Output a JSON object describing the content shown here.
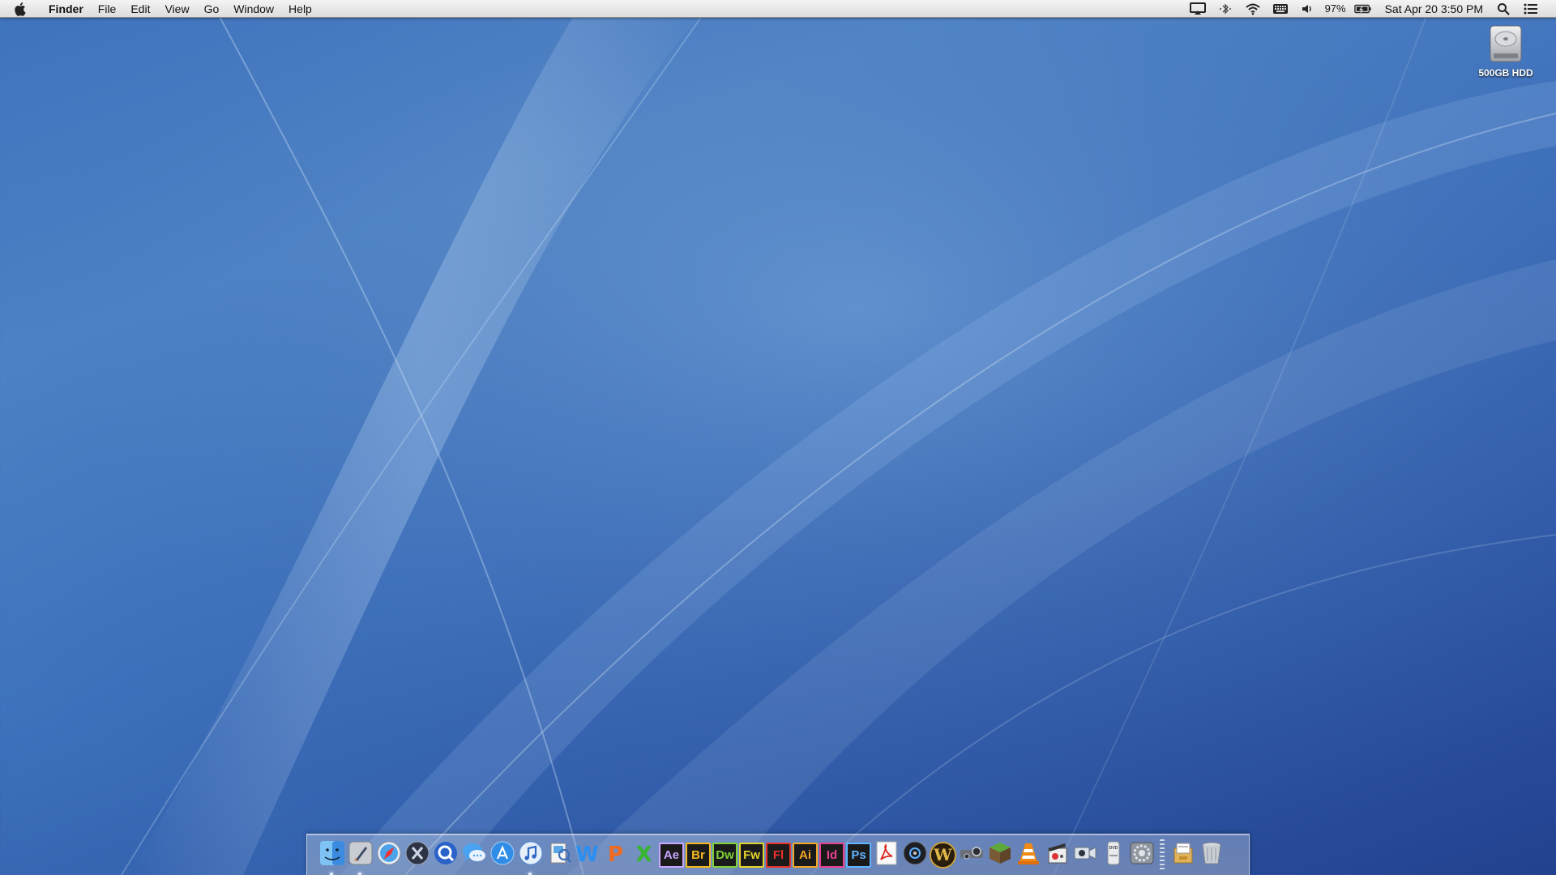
{
  "menubar": {
    "apple_icon": "apple-logo-icon",
    "app_name": "Finder",
    "menus": [
      "File",
      "Edit",
      "View",
      "Go",
      "Window",
      "Help"
    ],
    "status": {
      "battery_percent": "97%",
      "clock": "Sat Apr 20  3:50 PM",
      "icons": [
        "airplay-icon",
        "bluetooth-icon",
        "wifi-icon",
        "keyboard-icon",
        "volume-icon",
        "battery-icon",
        "spotlight-search-icon",
        "notification-list-icon"
      ]
    }
  },
  "desktop": {
    "hdd_label": "500GB HDD",
    "hdd_icon": "hard-drive-icon"
  },
  "dock": {
    "apps": [
      {
        "name": "finder",
        "icon": "finder-icon",
        "running": true
      },
      {
        "name": "launchpad",
        "icon": "launchpad-rocket-icon",
        "running": true
      },
      {
        "name": "safari",
        "icon": "safari-compass-icon",
        "running": false
      },
      {
        "name": "mission-control",
        "icon": "mission-control-x-icon",
        "running": false
      },
      {
        "name": "quicktime",
        "icon": "quicktime-q-icon",
        "running": false
      },
      {
        "name": "messages",
        "icon": "messages-bubble-icon",
        "running": false
      },
      {
        "name": "app-store",
        "icon": "app-store-icon",
        "running": false
      },
      {
        "name": "itunes",
        "icon": "itunes-note-icon",
        "running": true
      },
      {
        "name": "preview",
        "icon": "preview-icon",
        "running": false
      },
      {
        "name": "word",
        "icon": "word-w-icon",
        "label": "W",
        "running": false
      },
      {
        "name": "powerpoint",
        "icon": "powerpoint-p-icon",
        "label": "P",
        "running": false
      },
      {
        "name": "excel",
        "icon": "excel-x-icon",
        "label": "X",
        "running": false
      },
      {
        "name": "after-effects",
        "icon": "after-effects-icon",
        "label": "Ae",
        "color": "#c9a6ff",
        "running": false
      },
      {
        "name": "bridge",
        "icon": "bridge-icon",
        "label": "Br",
        "color": "#f2b81c",
        "running": false
      },
      {
        "name": "dreamweaver",
        "icon": "dreamweaver-icon",
        "label": "Dw",
        "color": "#7fd235",
        "running": false
      },
      {
        "name": "fireworks",
        "icon": "fireworks-icon",
        "label": "Fw",
        "color": "#e3d42b",
        "running": false
      },
      {
        "name": "flash",
        "icon": "flash-icon",
        "label": "Fl",
        "color": "#e8322a",
        "running": false
      },
      {
        "name": "illustrator",
        "icon": "illustrator-icon",
        "label": "Ai",
        "color": "#f5a623",
        "running": false
      },
      {
        "name": "indesign",
        "icon": "indesign-icon",
        "label": "Id",
        "color": "#e8408f",
        "running": false
      },
      {
        "name": "photoshop",
        "icon": "photoshop-icon",
        "label": "Ps",
        "color": "#5fb4ff",
        "running": false
      },
      {
        "name": "acrobat",
        "icon": "acrobat-pdf-icon",
        "running": false
      },
      {
        "name": "dvd-player",
        "icon": "dvd-disc-icon",
        "running": false
      },
      {
        "name": "world-of-warcraft",
        "icon": "warcraft-w-icon",
        "label": "W",
        "running": false
      },
      {
        "name": "steam",
        "icon": "steam-icon",
        "running": false
      },
      {
        "name": "minecraft",
        "icon": "minecraft-block-icon",
        "running": false
      },
      {
        "name": "vlc",
        "icon": "vlc-cone-icon",
        "running": false
      },
      {
        "name": "movie-app",
        "icon": "clapper-icon",
        "running": false
      },
      {
        "name": "facetime",
        "icon": "facetime-camera-icon",
        "running": false
      },
      {
        "name": "dvd-drive",
        "icon": "dvd-drive-icon",
        "running": false
      },
      {
        "name": "system-preferences",
        "icon": "system-preferences-gear-icon",
        "running": false
      }
    ],
    "stacks": [
      {
        "name": "documents-stack",
        "icon": "documents-stack-icon"
      },
      {
        "name": "trash",
        "icon": "trash-can-icon"
      }
    ]
  }
}
